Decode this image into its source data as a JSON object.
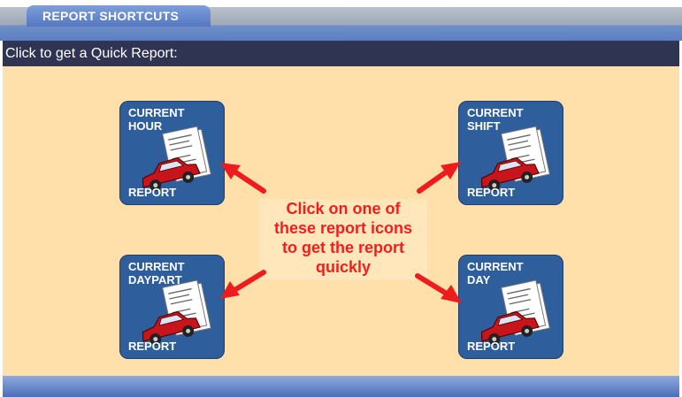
{
  "tab": {
    "label": "REPORT SHORTCUTS"
  },
  "header": {
    "title": "Click to get a Quick Report:"
  },
  "tiles": [
    {
      "title": "CURRENT\nHOUR",
      "footer": "REPORT"
    },
    {
      "title": "CURRENT\nSHIFT",
      "footer": "REPORT"
    },
    {
      "title": "CURRENT\nDAYPART",
      "footer": "REPORT"
    },
    {
      "title": "CURRENT\nDAY",
      "footer": "REPORT"
    }
  ],
  "callout": {
    "text": "Click on one of\nthese report icons\nto get the report\nquickly"
  },
  "icons": {
    "tile_art": "car-report-icon",
    "pointer": "red-arrow-icon"
  },
  "colors": {
    "tile": "#2f5e9c",
    "callout_text": "#f21e1e",
    "panel": "#ffdfaa",
    "header": "#2e3452"
  }
}
